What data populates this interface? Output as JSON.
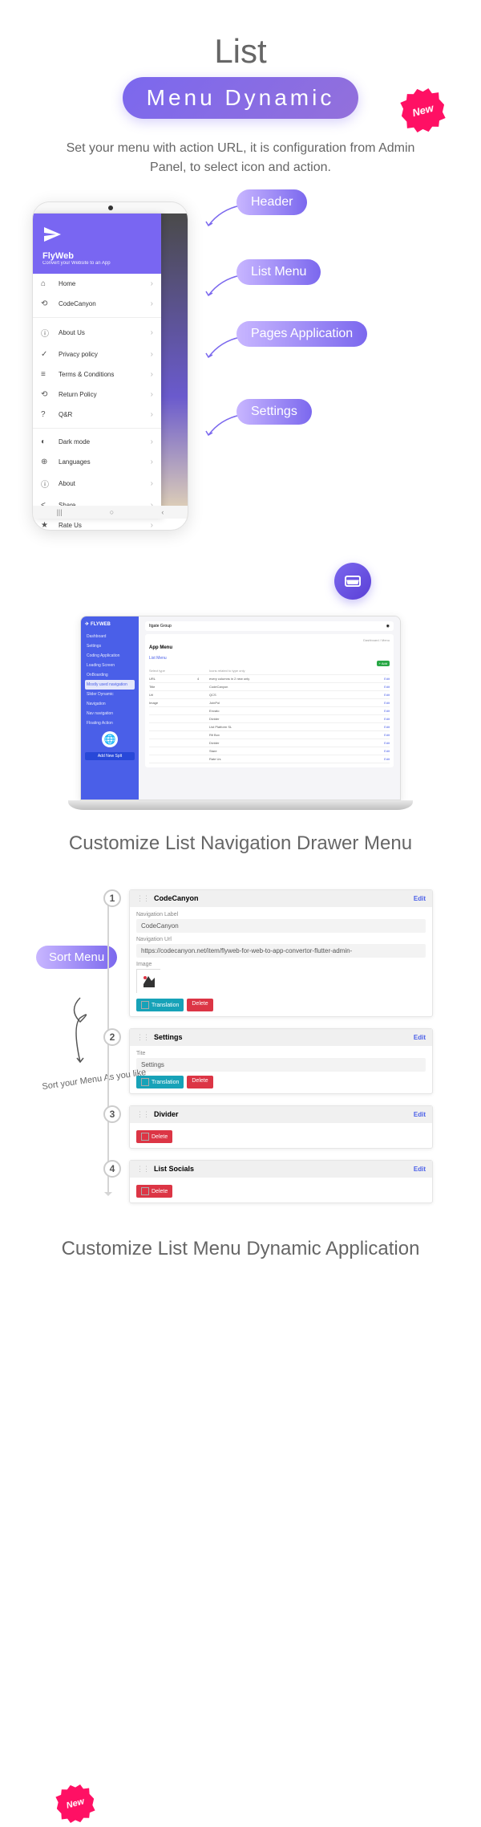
{
  "header": {
    "title": "List",
    "subtitle_pill": "Menu Dynamic",
    "new_badge": "New",
    "description": "Set your menu with action URL, it is configuration from Admin Panel, to select icon and action."
  },
  "phone": {
    "drawer_title": "FlyWeb",
    "drawer_subtitle": "Convert your Website to an App",
    "menu": {
      "group1": [
        {
          "icon": "⌂",
          "label": "Home"
        },
        {
          "icon": "⟲",
          "label": "CodeCanyon"
        }
      ],
      "group2": [
        {
          "icon": "ⓘ",
          "label": "About Us"
        },
        {
          "icon": "✓",
          "label": "Privacy policy"
        },
        {
          "icon": "≡",
          "label": "Terms & Conditions"
        },
        {
          "icon": "⟲",
          "label": "Return Policy"
        },
        {
          "icon": "?",
          "label": "Q&R"
        }
      ],
      "group3": [
        {
          "icon": "◐",
          "label": "Dark mode"
        },
        {
          "icon": "⊕",
          "label": "Languages"
        },
        {
          "icon": "ⓘ",
          "label": "About"
        },
        {
          "icon": "<",
          "label": "Share"
        },
        {
          "icon": "★",
          "label": "Rate Us"
        }
      ]
    }
  },
  "side_labels": [
    "Header",
    "List Menu",
    "Pages Application",
    "Settings"
  ],
  "laptop": {
    "brand": "FLYWEB",
    "sidebar": [
      "Dashboard",
      "Settings",
      "Coding Application",
      "Loading Screen",
      "OnBoarding",
      "Mostly used navigation",
      "Slider Dynamic",
      "Navigation",
      "Nav navigation",
      "Floating Action"
    ],
    "button": "Add New Splt",
    "page_title": "App Menu",
    "section_title": "List Menu",
    "breadcrumb": "Dashboard / Menu",
    "header_user": "Itgate Group",
    "add_btn": "+ Add",
    "col_headers": [
      "Select type",
      "",
      "Icons related to type only",
      ""
    ],
    "rows": [
      {
        "c1": "URL",
        "c2": "4",
        "c3": "every columns in 2 new only",
        "c4": "Edit"
      },
      {
        "c1": "Title",
        "c2": "",
        "c3": "CodeCanyon",
        "c4": "Edit"
      },
      {
        "c1": "Url",
        "c2": "",
        "c3": "QCS",
        "c4": "Edit"
      },
      {
        "c1": "Image",
        "c2": "",
        "c3": "JoinPol",
        "c4": "Edit"
      },
      {
        "c1": "",
        "c2": "",
        "c3": "Envato",
        "c4": "Edit"
      },
      {
        "c1": "",
        "c2": "",
        "c3": "Divider",
        "c4": "Edit"
      },
      {
        "c1": "",
        "c2": "",
        "c3": "List Platform SL",
        "c4": "Edit"
      },
      {
        "c1": "",
        "c2": "",
        "c3": "Rtl Box",
        "c4": "Edit"
      },
      {
        "c1": "",
        "c2": "",
        "c3": "Divider",
        "c4": "Edit"
      },
      {
        "c1": "",
        "c2": "",
        "c3": "Stare",
        "c4": "Edit"
      },
      {
        "c1": "",
        "c2": "",
        "c3": "Rate Us",
        "c4": "Edit"
      }
    ]
  },
  "section_titles": {
    "one": "Customize List Navigation Drawer Menu",
    "two": "Customize List Menu Dynamic Application"
  },
  "sort": {
    "pill": "Sort Menu",
    "text": "Sort your Menu As you like"
  },
  "cards": [
    {
      "num": "1",
      "title": "CodeCanyon",
      "edit": "Edit",
      "fields": [
        {
          "label": "Navigation Label",
          "value": "CodeCanyon"
        },
        {
          "label": "Navigation Url",
          "value": "https://codecanyon.net/item/flyweb-for-web-to-app-convertor-flutter-admin-"
        }
      ],
      "image_label": "Image",
      "buttons": [
        {
          "label": "Translation",
          "cls": "btn-blue",
          "chk": true
        },
        {
          "label": "Delete",
          "cls": "btn-red"
        }
      ]
    },
    {
      "num": "2",
      "title": "Settings",
      "edit": "Edit",
      "fields": [
        {
          "label": "Tite",
          "value": "Settings"
        }
      ],
      "buttons": [
        {
          "label": "Translation",
          "cls": "btn-blue",
          "chk": true
        },
        {
          "label": "Delete",
          "cls": "btn-red"
        }
      ]
    },
    {
      "num": "3",
      "title": "Divider",
      "edit": "Edit",
      "buttons": [
        {
          "label": "Delete",
          "cls": "btn-red",
          "chk": true
        }
      ]
    },
    {
      "num": "4",
      "title": "List Socials",
      "edit": "Edit",
      "buttons": [
        {
          "label": "Delete",
          "cls": "btn-red",
          "chk": true
        }
      ]
    }
  ]
}
